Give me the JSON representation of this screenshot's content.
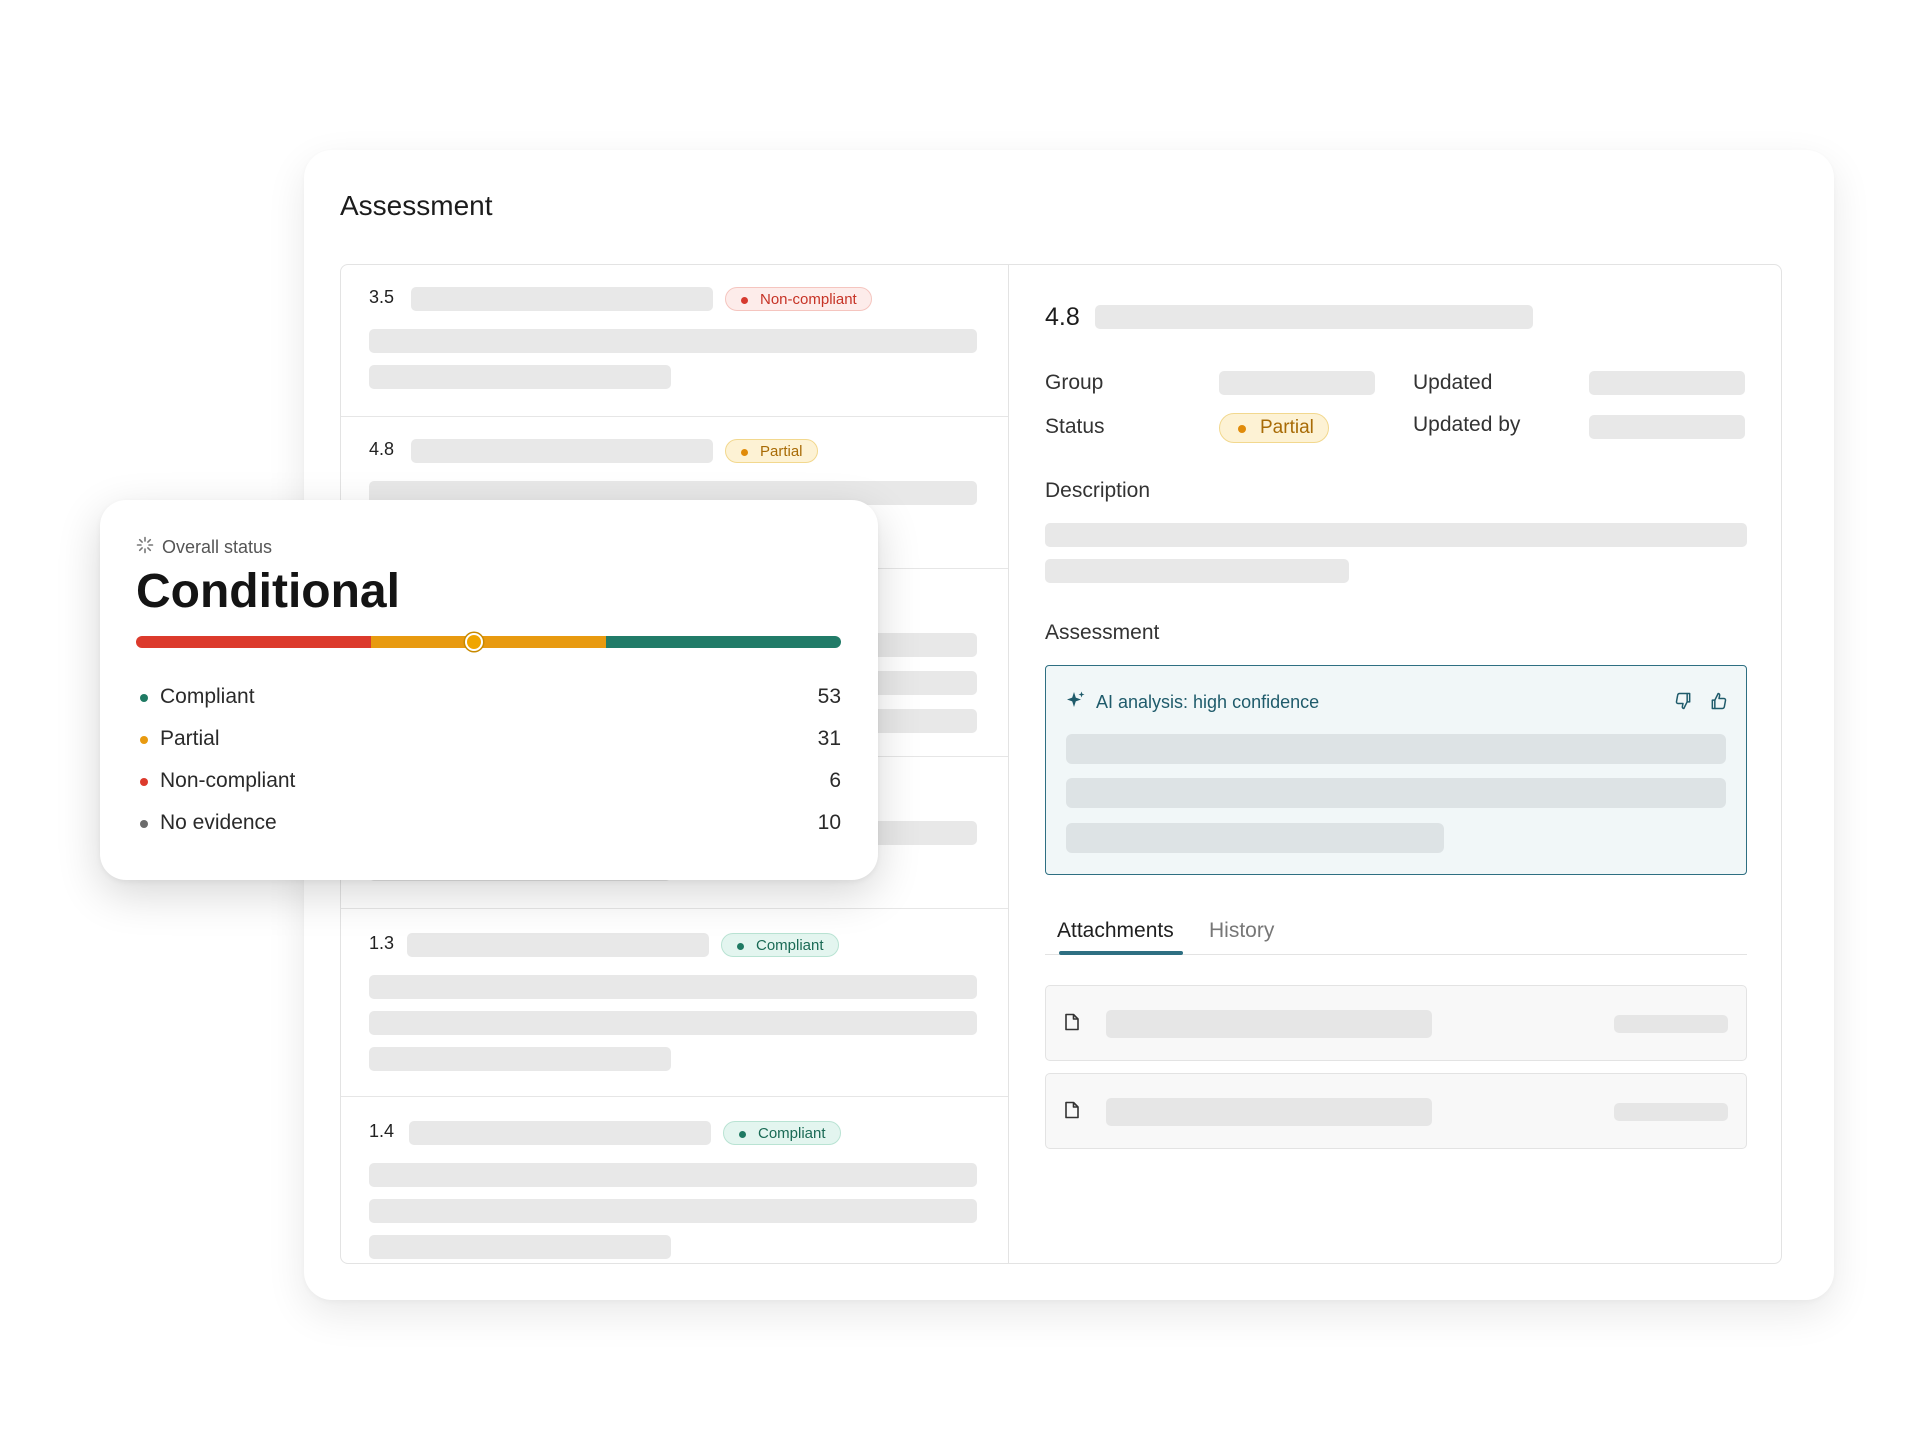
{
  "card": {
    "title": "Assessment"
  },
  "requirements": [
    {
      "number": "3.5",
      "status": "Non-compliant",
      "kind": "nc"
    },
    {
      "number": "4.8",
      "status": "Partial",
      "kind": "partial"
    },
    {
      "number": "",
      "status": "",
      "kind": ""
    },
    {
      "number": "",
      "status": "",
      "kind": ""
    },
    {
      "number": "1.3",
      "status": "Compliant",
      "kind": "comp"
    },
    {
      "number": "1.4",
      "status": "Compliant",
      "kind": "comp"
    }
  ],
  "detail": {
    "number": "4.8",
    "group_label": "Group",
    "status_label": "Status",
    "status_value": "Partial",
    "updated_label": "Updated",
    "updated_by_label": "Updated by",
    "description_label": "Description",
    "assessment_label": "Assessment",
    "ai_analysis": "AI analysis: high confidence",
    "tabs": [
      {
        "label": "Attachments",
        "active": true
      },
      {
        "label": "History",
        "active": false
      }
    ]
  },
  "overall": {
    "label": "Overall status",
    "value": "Conditional",
    "marker_fraction": 0.479,
    "legend": [
      {
        "label": "Compliant",
        "count": "53",
        "color": "#1f7a63"
      },
      {
        "label": "Partial",
        "count": "31",
        "color": "#e89a10"
      },
      {
        "label": "Non-compliant",
        "count": "6",
        "color": "#dc3a2c"
      },
      {
        "label": "No evidence",
        "count": "10",
        "color": "#6b6b6b"
      }
    ]
  },
  "colors": {
    "non_compliant": "#dc3a2c",
    "partial": "#e89a10",
    "compliant": "#217b68",
    "accent": "#2e6f82"
  },
  "icons": {
    "overall_status": "sparkle-loader-icon",
    "ai": "sparkle-icon",
    "thumbs_down": "thumbs-down-icon",
    "thumbs_up": "thumbs-up-icon",
    "attachment": "file-icon"
  }
}
